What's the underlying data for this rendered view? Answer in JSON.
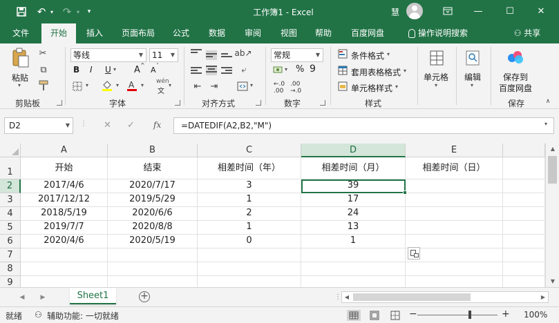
{
  "titlebar": {
    "title": "工作簿1  -  Excel",
    "user": "慧",
    "save_icon": "💾",
    "undo_icon": "↶",
    "redo_icon": "↷",
    "customize_icon": "▾",
    "ribbon_display_icon": "▭",
    "minimize": "—",
    "maximize": "☐",
    "close": "✕"
  },
  "tabs": [
    "文件",
    "开始",
    "插入",
    "页面布局",
    "公式",
    "数据",
    "审阅",
    "视图",
    "帮助",
    "百度网盘",
    "操作说明搜索",
    "共享"
  ],
  "ribbon": {
    "clipboard": {
      "paste": "粘贴",
      "label": "剪贴板"
    },
    "font": {
      "name": "等线",
      "size": "11",
      "bold": "B",
      "italic": "I",
      "underline": "U",
      "grow": "A",
      "shrink": "A",
      "label": "字体",
      "phonetic": "wén"
    },
    "alignment": {
      "label": "对齐方式"
    },
    "number": {
      "format": "常规",
      "percent": "%",
      "comma": "9",
      "label": "数字"
    },
    "styles": {
      "conditional": "条件格式",
      "table": "套用表格格式",
      "cell": "单元格样式",
      "label": "样式"
    },
    "cells": {
      "label": "单元格"
    },
    "editing": {
      "label": "编辑"
    },
    "save": {
      "label1": "保存到",
      "label2": "百度网盘",
      "label": "保存"
    }
  },
  "formula_bar": {
    "name_box": "D2",
    "cancel": "✕",
    "enter": "✓",
    "fx": "fx",
    "formula": "=DATEDIF(A2,B2,\"M\")"
  },
  "grid": {
    "columns": [
      "A",
      "B",
      "C",
      "D",
      "E"
    ],
    "rows": [
      "1",
      "2",
      "3",
      "4",
      "5",
      "6",
      "7",
      "8",
      "9"
    ],
    "headers": [
      "开始",
      "结束",
      "相差时间（年）",
      "相差时间（月）",
      "相差时间（日）"
    ],
    "data": [
      [
        "2017/4/6",
        "2020/7/17",
        "3",
        "39",
        ""
      ],
      [
        "2017/12/12",
        "2019/5/29",
        "1",
        "17",
        ""
      ],
      [
        "2018/5/19",
        "2020/6/6",
        "2",
        "24",
        ""
      ],
      [
        "2019/7/7",
        "2020/8/8",
        "1",
        "13",
        ""
      ],
      [
        "2020/4/6",
        "2020/5/19",
        "0",
        "1",
        ""
      ]
    ]
  },
  "sheets": {
    "active": "Sheet1",
    "add": "+"
  },
  "status": {
    "ready": "就绪",
    "accessibility": "辅助功能: 一切就绪",
    "zoom_minus": "−",
    "zoom_plus": "+",
    "zoom": "100%"
  },
  "colors": {
    "accent": "#217346",
    "selected_header": "#d3e6d9"
  }
}
